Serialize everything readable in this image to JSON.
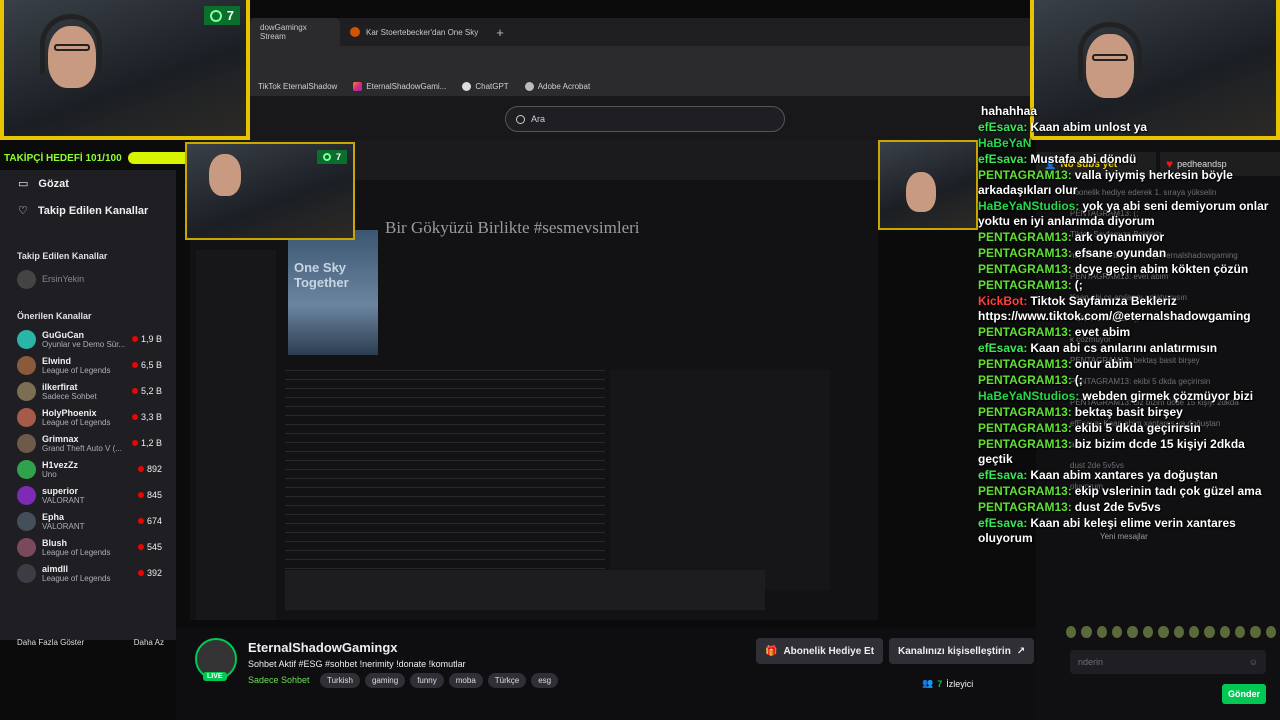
{
  "colors": {
    "twitch_green": "#00c853",
    "overlay_border": "#e8c300",
    "goal_text": "#8dff2f",
    "goal_fill": "#d9f400",
    "usr_efesava": "#3ee65a",
    "usr_habeyan": "#25d94b",
    "usr_pentagram": "#5fe034",
    "usr_kickbot": "#ff4040"
  },
  "browser": {
    "tabs": [
      "dowGamingx Stream",
      "Kar Stoertebecker'dan One Sky"
    ],
    "bookmarks": [
      "TikTok EternalShadow",
      "EternalShadowGami...",
      "ChatGPT",
      "Adobe Acrobat"
    ],
    "search_placeholder": "Ara"
  },
  "overlay": {
    "follower_count": "7",
    "follower_goal_label": "TAKİPÇİ HEDEFİ 101/100",
    "follower_goal_progress": 1.0,
    "no_subs": "No subs yet",
    "pedhe": "pedheandsp"
  },
  "sidebar": {
    "nav": [
      {
        "label": "Gözat",
        "icon": "browse-icon"
      },
      {
        "label": "Takip Edilen Kanallar",
        "icon": "heart-icon"
      }
    ],
    "followed_title": "Takip Edilen Kanallar",
    "followed": [
      {
        "name": "ErsinYekin"
      }
    ],
    "recommended_title": "Önerilen Kanallar",
    "recommended": [
      {
        "name": "GuGuCan",
        "game": "Oyunlar ve Demo Sür...",
        "viewers": "1,9 B"
      },
      {
        "name": "Elwind",
        "game": "League of Legends",
        "viewers": "6,5 B"
      },
      {
        "name": "ilkerfirat",
        "game": "Sadece Sohbet",
        "viewers": "5,2 B"
      },
      {
        "name": "HolyPhoenix",
        "game": "League of Legends",
        "viewers": "3,3 B"
      },
      {
        "name": "Grimnax",
        "game": "Grand Theft Auto V (...",
        "viewers": "1,2 B"
      },
      {
        "name": "H1vezZz",
        "game": "Uno",
        "viewers": "892"
      },
      {
        "name": "superior",
        "game": "VALORANT",
        "viewers": "845"
      },
      {
        "name": "Epha",
        "game": "VALORANT",
        "viewers": "674"
      },
      {
        "name": "Blush",
        "game": "League of Legends",
        "viewers": "545"
      },
      {
        "name": "aimdll",
        "game": "League of Legends",
        "viewers": "392"
      }
    ],
    "show_more": "Daha Fazla Göster",
    "show_less": "Daha Az"
  },
  "content": {
    "title": "Bir Gökyüzü Birlikte #sesmevsimleri",
    "album_text": "One Sky Together"
  },
  "channel": {
    "name": "EternalShadowGamingx",
    "live": "LIVE",
    "title": "Sohbet Aktif #ESG #sohbet  !nerimity !donate !komutlar",
    "category": "Sadece Sohbet",
    "tags": [
      "Turkish",
      "gaming",
      "funny",
      "moba",
      "Türkçe",
      "esg"
    ],
    "gift_sub": "Abonelik Hediye Et",
    "customize": "Kanalınızı kişiselleştirin",
    "viewers": "7",
    "viewers_label": "İzleyici"
  },
  "chat": {
    "bg_lines": [
      "abonelik hediye ederek 1. sıraya yükselin",
      "PENTAGRAM13: (;",
      "Tiktok Sayfamıza Bekleriz",
      "https://www.tiktok.com/@eternalshadowgaming",
      "PENTAGRAM13: evet abim",
      "Kaan abi cs anılarını anlatırmısın",
      "PENTAGRAM13: (;",
      "k çözmüyor",
      "PENTAGRAM13: bektaş basit birşey",
      "PENTAGRAM13: ekibi 5 dkda geçirirsin",
      "PENTAGRAM13: biz bizim dcde 15 kişiyi 2dkda",
      "efEsava: Kaan abim xantares ya doğuştan",
      "ama",
      "dust 2de 5v5vs",
      "oluyorum"
    ],
    "new_messages": "Yeni mesajlar",
    "input_placeholder": "nderin",
    "send": "Gönder",
    "overlay_messages": [
      {
        "user": "",
        "text": "hahahhaa",
        "color": "usr_pentagram"
      },
      {
        "user": "efEsava:",
        "text": "Kaan abim unlost ya",
        "color": "usr_efesava"
      },
      {
        "user": "HaBeYaN",
        "text": "",
        "color": "usr_habeyan"
      },
      {
        "user": "efEsava:",
        "text": "Mustafa abi döndü",
        "color": "usr_efesava"
      },
      {
        "user": "PENTAGRAM13:",
        "text": "valla iyiymiş herkesin böyle arkadaşıkları olur",
        "color": "usr_pentagram"
      },
      {
        "user": "HaBeYaNStudios:",
        "text": "yok ya abi seni demiyorum onlar yoktu en iyi anlarımda diyorum",
        "color": "usr_habeyan"
      },
      {
        "user": "PENTAGRAM13:",
        "text": "ark oynanmıyor",
        "color": "usr_pentagram"
      },
      {
        "user": "PENTAGRAM13:",
        "text": "efsane oyundan",
        "color": "usr_pentagram"
      },
      {
        "user": "PENTAGRAM13:",
        "text": "dcye geçin abim kökten çözün",
        "color": "usr_pentagram"
      },
      {
        "user": "PENTAGRAM13:",
        "text": "(;",
        "color": "usr_pentagram"
      },
      {
        "user": "KickBot:",
        "text": "Tiktok Sayfamıza Bekleriz https://www.tiktok.com/@eternalshadowgaming",
        "color": "usr_kickbot"
      },
      {
        "user": "PENTAGRAM13:",
        "text": "evet abim",
        "color": "usr_pentagram"
      },
      {
        "user": "efEsava:",
        "text": "Kaan abi cs anılarını anlatırmısın",
        "color": "usr_efesava"
      },
      {
        "user": "PENTAGRAM13:",
        "text": "onur abim",
        "color": "usr_pentagram"
      },
      {
        "user": "PENTAGRAM13:",
        "text": "(;",
        "color": "usr_pentagram"
      },
      {
        "user": "HaBeYaNStudios:",
        "text": "webden girmek çözmüyor bizi",
        "color": "usr_habeyan"
      },
      {
        "user": "PENTAGRAM13:",
        "text": "bektaş basit birşey",
        "color": "usr_pentagram"
      },
      {
        "user": "PENTAGRAM13:",
        "text": "ekibi 5 dkda geçirirsin",
        "color": "usr_pentagram"
      },
      {
        "user": "PENTAGRAM13:",
        "text": "biz bizim dcde 15 kişiyi 2dkda geçtik",
        "color": "usr_pentagram"
      },
      {
        "user": "efEsava:",
        "text": "Kaan abim xantares ya doğuştan",
        "color": "usr_efesava"
      },
      {
        "user": "PENTAGRAM13:",
        "text": "ekip vslerinin tadı çok güzel ama",
        "color": "usr_pentagram"
      },
      {
        "user": "PENTAGRAM13:",
        "text": "dust 2de 5v5vs",
        "color": "usr_pentagram"
      },
      {
        "user": "efEsava:",
        "text": "Kaan abi keleşi elime verin xantares oluyorum",
        "color": "usr_efesava"
      }
    ]
  }
}
